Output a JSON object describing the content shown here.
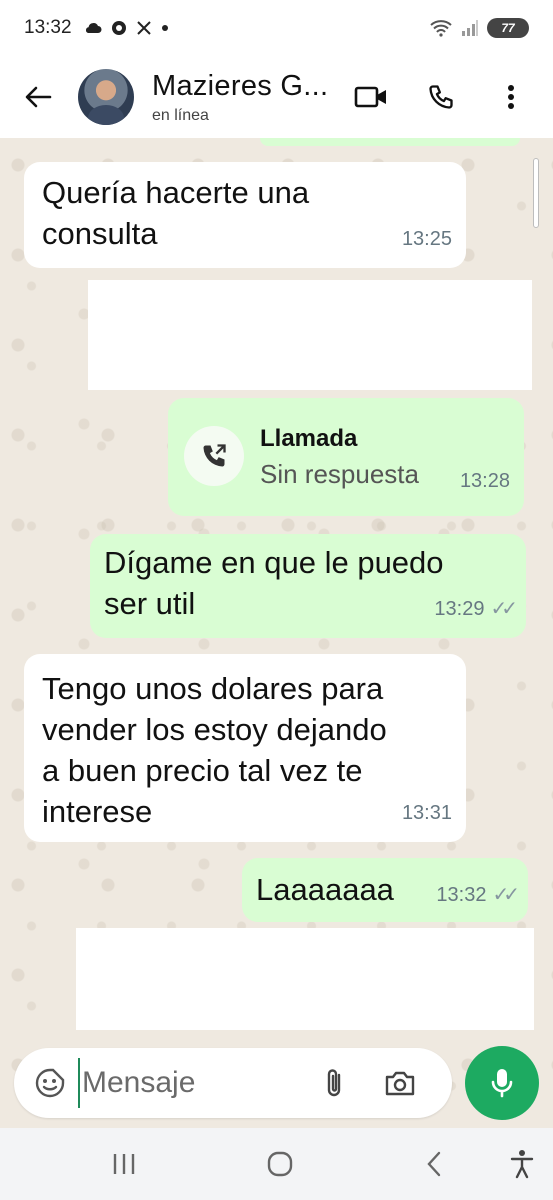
{
  "status_bar": {
    "time": "13:32",
    "left_icons": [
      "cloud-icon",
      "whatsapp-icon",
      "x-logo-icon",
      "dot-icon"
    ],
    "battery": "77"
  },
  "header": {
    "contact_name": "Mazieres G...",
    "contact_status": "en línea"
  },
  "messages": [
    {
      "direction": "incoming",
      "text_lines": [
        "Quería hacerte una",
        "consulta"
      ],
      "time": "13:25"
    },
    {
      "direction": "incoming",
      "redacted": true
    },
    {
      "direction": "outgoing",
      "type": "call",
      "title": "Llamada",
      "subtitle": "Sin respuesta",
      "time": "13:28"
    },
    {
      "direction": "outgoing",
      "text_lines": [
        "Dígame en que le puedo",
        "ser util"
      ],
      "time": "13:29",
      "read": true
    },
    {
      "direction": "incoming",
      "text_lines": [
        "Tengo unos dolares para",
        "vender los estoy dejando",
        "a buen precio tal vez te",
        "interese"
      ],
      "time": "13:31"
    },
    {
      "direction": "outgoing",
      "text_lines": [
        "Laaaaaaa"
      ],
      "time": "13:32",
      "read": true
    },
    {
      "direction": "incoming",
      "redacted": true
    }
  ],
  "composer": {
    "placeholder": "Mensaje"
  },
  "colors": {
    "header_bg": "#ffffff",
    "chat_bg": "#efe9e0",
    "outgoing_bubble": "#d9fdd3",
    "incoming_bubble": "#ffffff",
    "mic_button": "#1daa61",
    "meta_text": "#667781"
  }
}
